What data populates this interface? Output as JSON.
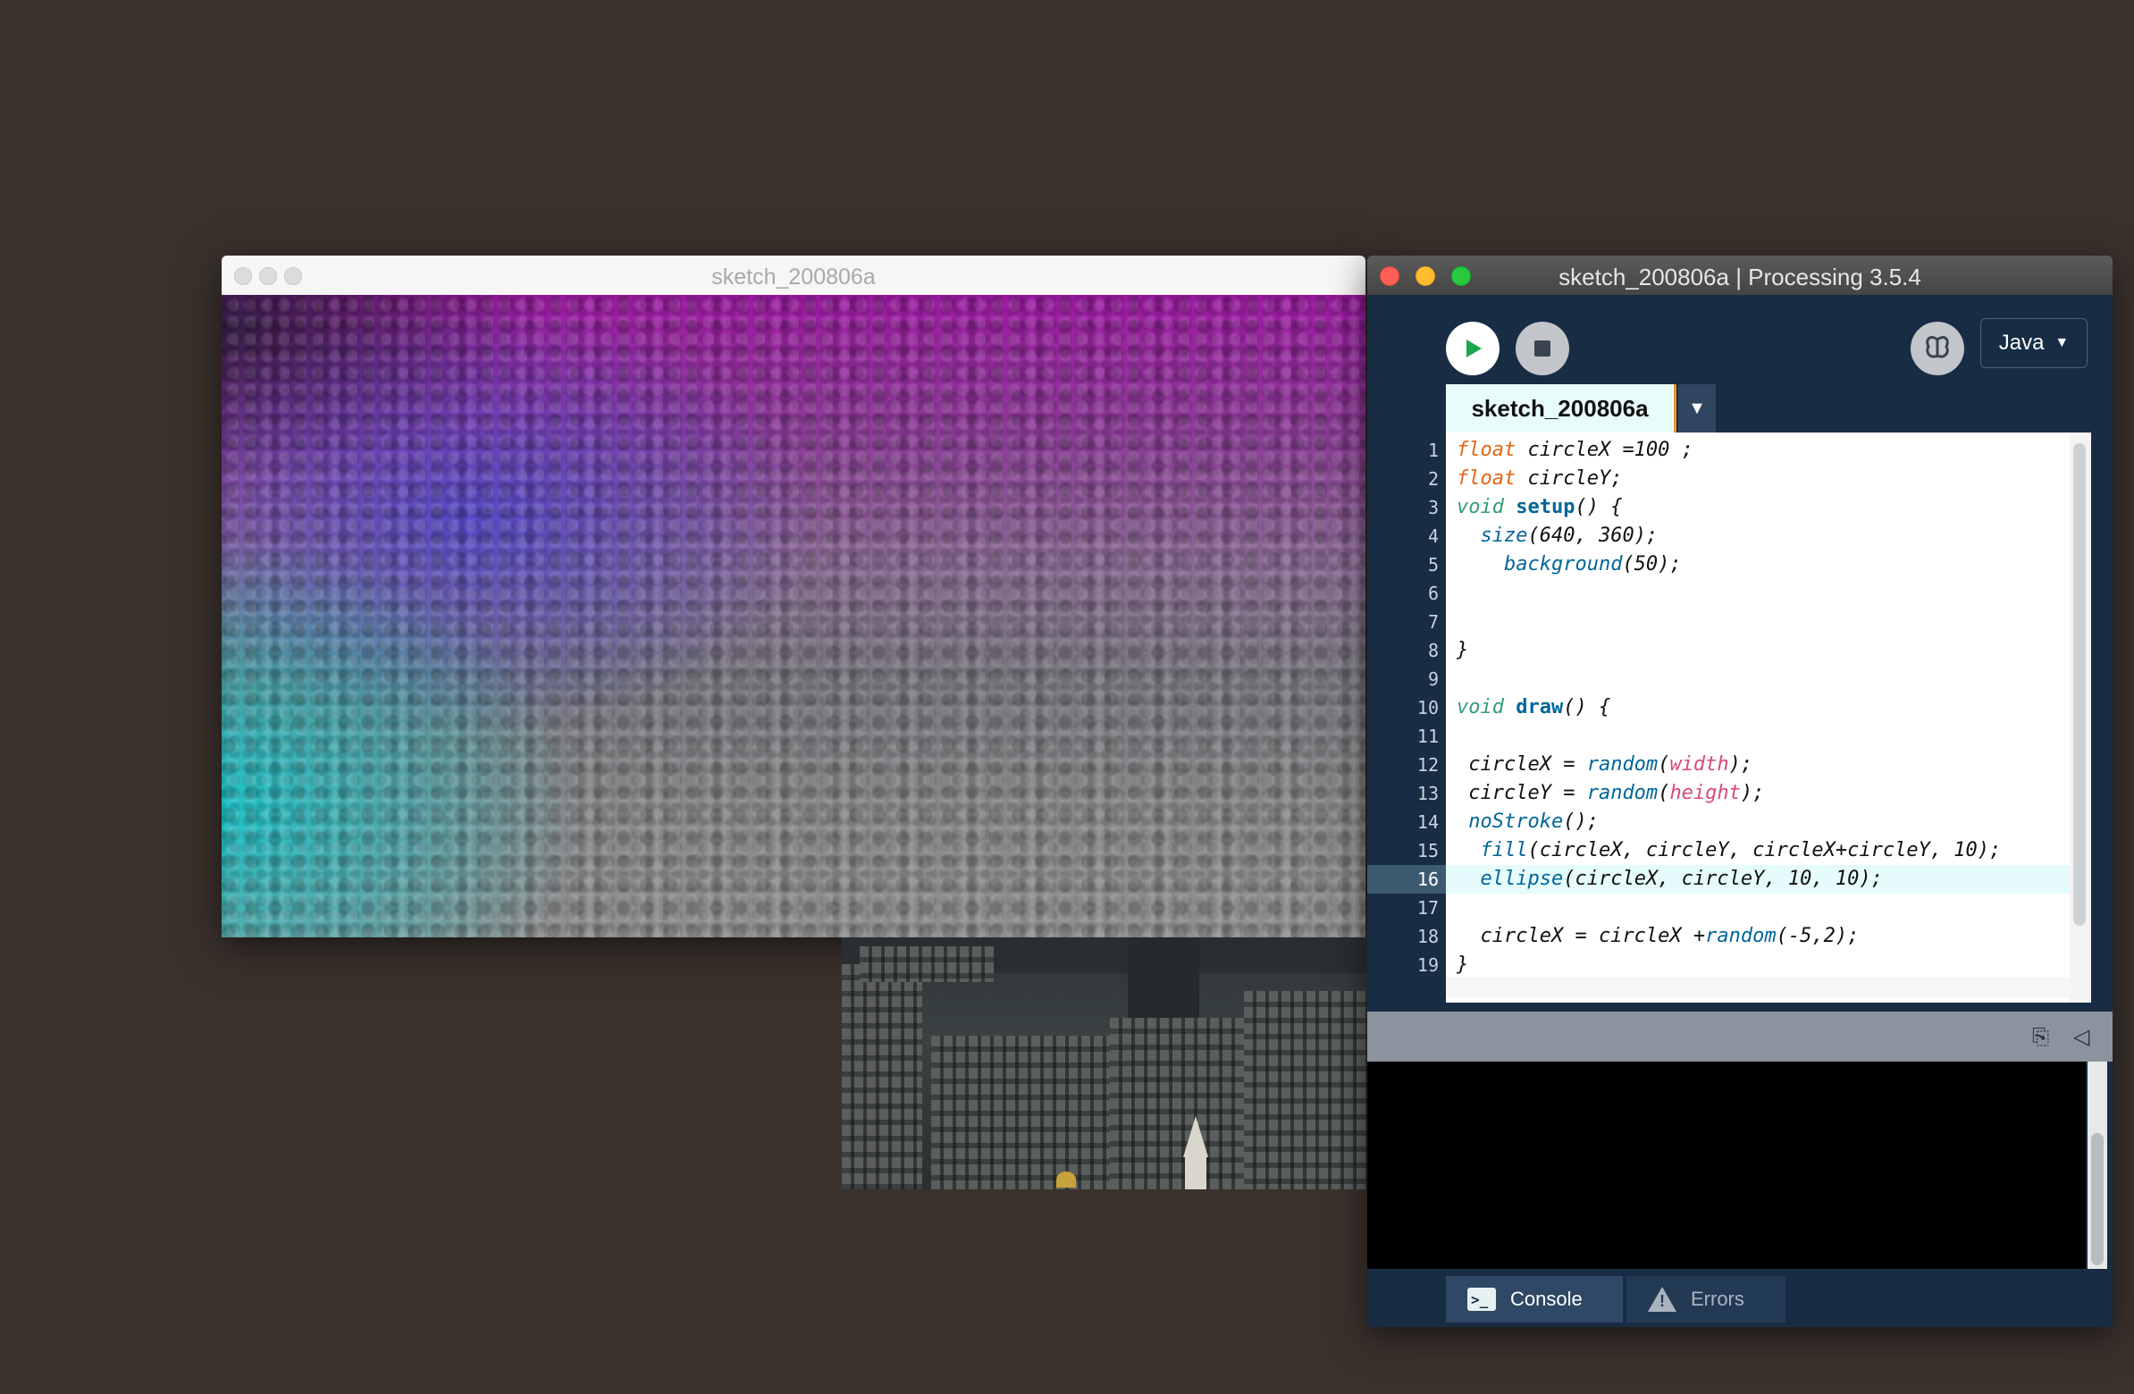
{
  "sketch_window": {
    "title": "sketch_200806a"
  },
  "ide_window": {
    "title": "sketch_200806a | Processing 3.5.4",
    "mode": "Java",
    "tab_label": "sketch_200806a",
    "active_line": 16
  },
  "code": [
    {
      "n": "1",
      "text": "float circleX =100 ;"
    },
    {
      "n": "2",
      "text": "float circleY;"
    },
    {
      "n": "3",
      "text": "void setup() {"
    },
    {
      "n": "4",
      "text": "  size(640, 360);"
    },
    {
      "n": "5",
      "text": "    background(50);"
    },
    {
      "n": "6",
      "text": ""
    },
    {
      "n": "7",
      "text": ""
    },
    {
      "n": "8",
      "text": "}"
    },
    {
      "n": "9",
      "text": ""
    },
    {
      "n": "10",
      "text": "void draw() {"
    },
    {
      "n": "11",
      "text": ""
    },
    {
      "n": "12",
      "text": " circleX = random(width);"
    },
    {
      "n": "13",
      "text": " circleY = random(height);"
    },
    {
      "n": "14",
      "text": " noStroke();"
    },
    {
      "n": "15",
      "text": "  fill(circleX, circleY, circleX+circleY, 10);"
    },
    {
      "n": "16",
      "text": "  ellipse(circleX, circleY, 10, 10);"
    },
    {
      "n": "17",
      "text": ""
    },
    {
      "n": "18",
      "text": "  circleX = circleX +random(-5,2);"
    },
    {
      "n": "19",
      "text": "}"
    }
  ],
  "bottom_tabs": {
    "console_label": "Console",
    "errors_label": "Errors"
  },
  "colors": {
    "desktop": "#3a312c",
    "ide_bg": "#182c44",
    "keyword": "#e2661a",
    "function": "#006699",
    "variable": "#d94a7a",
    "tab_accent": "#e8952c"
  },
  "icons": {
    "run": "play-icon",
    "stop": "stop-icon",
    "debug": "butterfly-icon",
    "copy": "copy-icon",
    "collapse": "triangle-left-icon",
    "console": "terminal-icon",
    "errors": "warning-icon"
  }
}
